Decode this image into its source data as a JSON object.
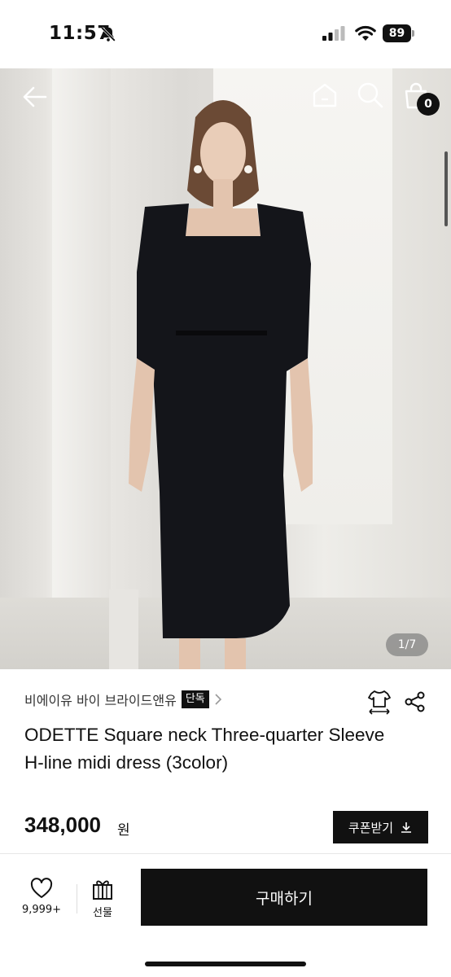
{
  "status_bar": {
    "time": "11:57",
    "battery": "89"
  },
  "hero": {
    "pager": "1/7",
    "cart_count": "0",
    "toolbar_icons": [
      "back-arrow-icon",
      "home-icon",
      "search-icon",
      "shopping-bag-icon"
    ]
  },
  "product": {
    "brand": "비에이유 바이 브라이드앤유",
    "exclusive_badge": "단독",
    "title": "ODETTE Square neck Three-quarter Sleeve H-line midi dress (3color)",
    "price": "348,000",
    "price_unit": "원",
    "coupon_label": "쿠폰받기"
  },
  "bottom_bar": {
    "like_count": "9,999+",
    "gift_label": "선물",
    "buy_label": "구매하기"
  },
  "colors": {
    "primary": "#111111",
    "background": "#ffffff"
  }
}
